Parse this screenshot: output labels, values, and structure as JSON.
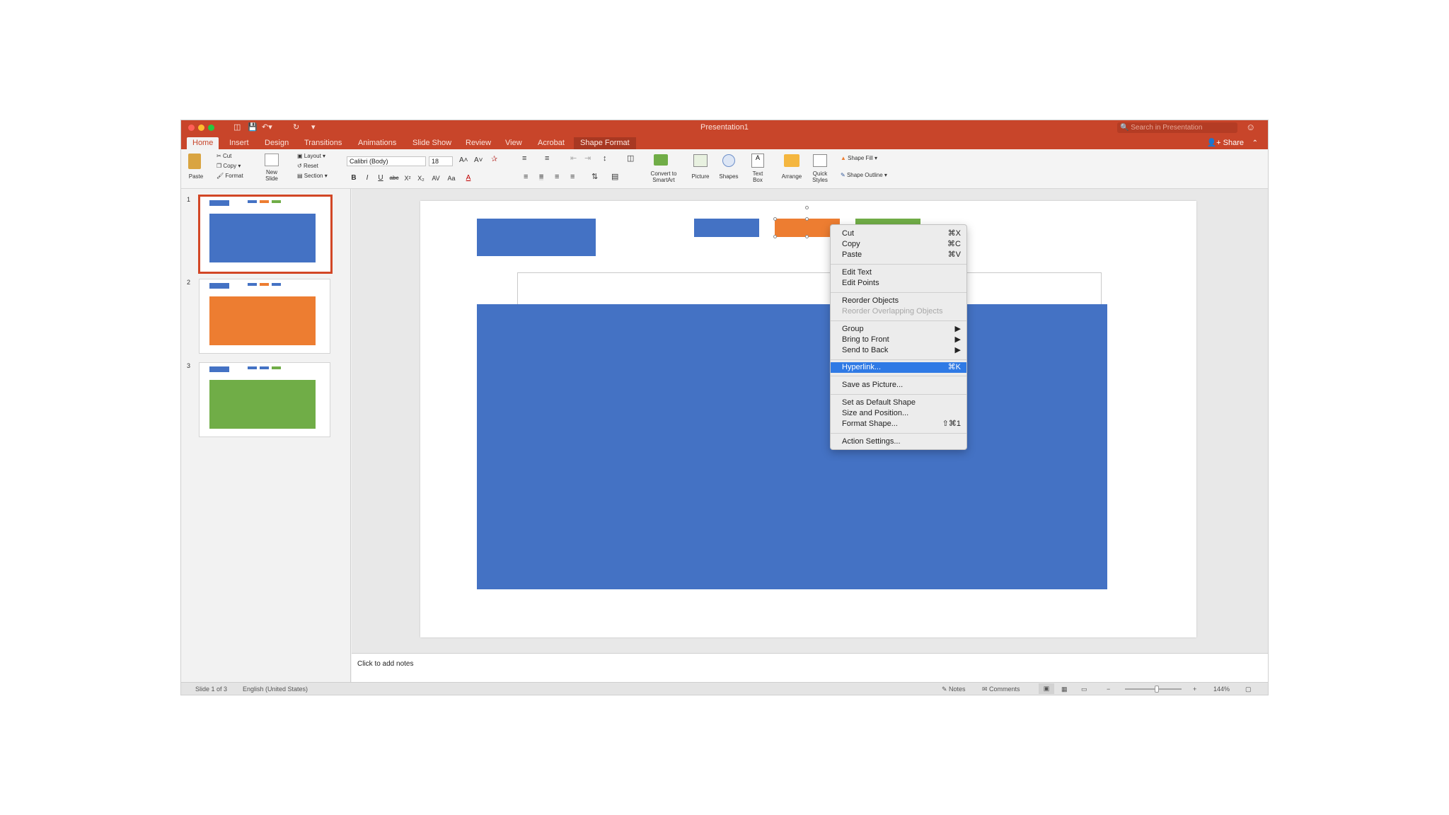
{
  "window": {
    "title": "Presentation1",
    "search_placeholder": "Search in Presentation",
    "share_label": "Share"
  },
  "tabs": [
    {
      "label": "Home"
    },
    {
      "label": "Insert"
    },
    {
      "label": "Design"
    },
    {
      "label": "Transitions"
    },
    {
      "label": "Animations"
    },
    {
      "label": "Slide Show"
    },
    {
      "label": "Review"
    },
    {
      "label": "View"
    },
    {
      "label": "Acrobat"
    },
    {
      "label": "Shape Format"
    }
  ],
  "ribbon": {
    "paste": "Paste",
    "cut": "Cut",
    "copy": "Copy",
    "format": "Format",
    "new_slide_1": "New",
    "new_slide_2": "Slide",
    "layout": "Layout",
    "reset": "Reset",
    "section": "Section",
    "font_name": "Calibri (Body)",
    "font_size": "18",
    "bold": "B",
    "italic": "I",
    "underline": "U",
    "strike": "abc",
    "superscript": "X²",
    "subscript": "X₂",
    "convert_1": "Convert to",
    "convert_2": "SmartArt",
    "picture": "Picture",
    "shapes": "Shapes",
    "textbox_1": "Text",
    "textbox_2": "Box",
    "arrange": "Arrange",
    "quick_styles_1": "Quick",
    "quick_styles_2": "Styles",
    "shape_fill": "Shape Fill",
    "shape_outline": "Shape Outline"
  },
  "thumbnails": [
    {
      "number": "1",
      "main_color": "#4472c4"
    },
    {
      "number": "2",
      "main_color": "#ed7d31"
    },
    {
      "number": "3",
      "main_color": "#70ad47"
    }
  ],
  "colors": {
    "accent_ribbon": "#c8452a",
    "blue": "#4472c4",
    "orange": "#ed7d31",
    "green": "#70ad47",
    "menu_highlight": "#2f7ae5"
  },
  "notes": {
    "placeholder": "Click to add notes"
  },
  "status": {
    "slide_info": "Slide 1 of 3",
    "language": "English (United States)",
    "notes": "Notes",
    "comments": "Comments",
    "zoom": "144%"
  },
  "context_menu": {
    "items": [
      {
        "label": "Cut",
        "shortcut": "⌘X"
      },
      {
        "label": "Copy",
        "shortcut": "⌘C"
      },
      {
        "label": "Paste",
        "shortcut": "⌘V"
      },
      {
        "label": "Edit Text",
        "shortcut": ""
      },
      {
        "label": "Edit Points",
        "shortcut": ""
      },
      {
        "label": "Reorder Objects",
        "shortcut": ""
      },
      {
        "label": "Reorder Overlapping Objects",
        "shortcut": ""
      },
      {
        "label": "Group",
        "shortcut": "▶"
      },
      {
        "label": "Bring to Front",
        "shortcut": "▶"
      },
      {
        "label": "Send to Back",
        "shortcut": "▶"
      },
      {
        "label": "Hyperlink...",
        "shortcut": "⌘K"
      },
      {
        "label": "Save as Picture...",
        "shortcut": ""
      },
      {
        "label": "Set as Default Shape",
        "shortcut": ""
      },
      {
        "label": "Size and Position...",
        "shortcut": ""
      },
      {
        "label": "Format Shape...",
        "shortcut": "⇧⌘1"
      },
      {
        "label": "Action Settings...",
        "shortcut": ""
      }
    ]
  }
}
